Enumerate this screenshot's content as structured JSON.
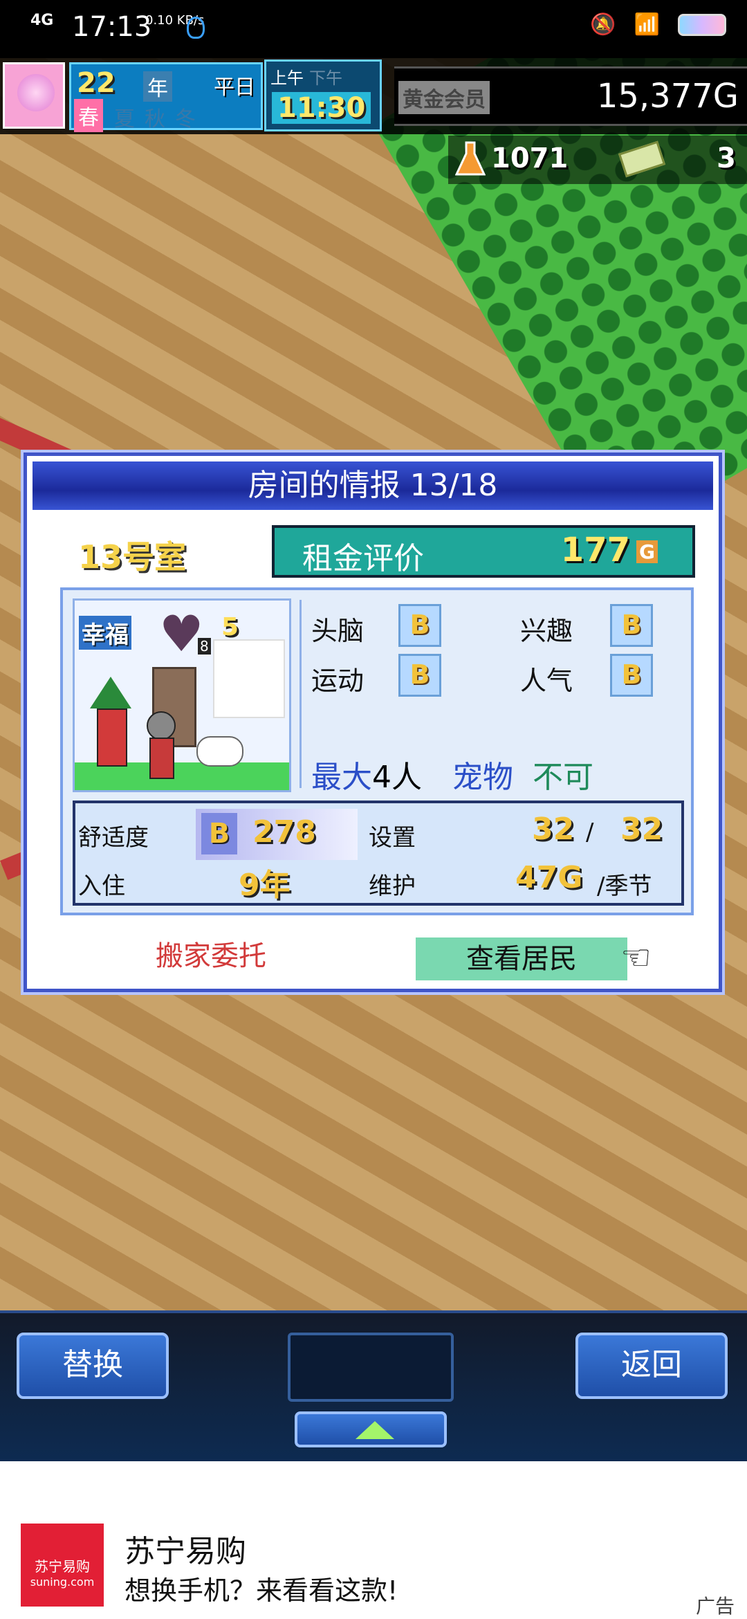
{
  "status_bar": {
    "network": "4G",
    "time": "17:13",
    "speed": "0.10 KB/s"
  },
  "hud": {
    "year": "22",
    "year_label": "年",
    "weekday": "平日",
    "season": "春",
    "other_seasons": "夏秋冬",
    "am": "上午",
    "pm": "下午",
    "clock": "11:30",
    "member": "黄金会员",
    "money": "15,377G",
    "research": "1071",
    "tickets": "3"
  },
  "dialog": {
    "title": "房间的情报 13/18",
    "room_no": "13号室",
    "rent_label": "租金评价",
    "rent_value": "177",
    "rent_unit": "G",
    "happiness_label": "幸福",
    "happiness_small": "8",
    "happiness_value": "5",
    "stats": [
      {
        "label": "头脑",
        "grade": "B"
      },
      {
        "label": "兴趣",
        "grade": "B"
      },
      {
        "label": "运动",
        "grade": "B"
      },
      {
        "label": "人气",
        "grade": "B"
      }
    ],
    "max_label": "最大",
    "max_value": "4人",
    "pet_label": "宠物",
    "pet_value": "不可",
    "comfort_label": "舒适度",
    "comfort_grade": "B",
    "comfort_value": "278",
    "setup_label": "设置",
    "setup_current": "32",
    "setup_sep": "/",
    "setup_max": "32",
    "residence_label": "入住",
    "residence_value": "9年",
    "maintain_label": "维护",
    "maintain_value": "47G",
    "maintain_unit": "/季节",
    "move_label": "搬家委托",
    "view_label": "查看居民"
  },
  "bottom": {
    "replace": "替换",
    "back": "返回"
  },
  "ad": {
    "brand": "苏宁易购",
    "brand_en": "suning.com",
    "title": "苏宁易购",
    "subtitle": "想换手机？来看看这款!",
    "tag": "广告"
  }
}
